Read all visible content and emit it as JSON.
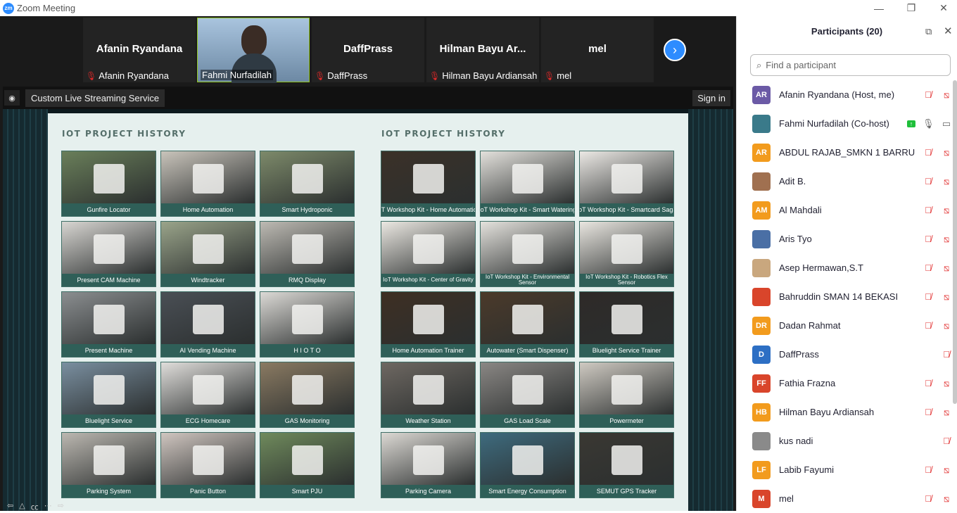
{
  "window": {
    "title": "Zoom Meeting",
    "logo": "zm"
  },
  "gallery": {
    "tiles": [
      {
        "name": "Afanin Ryandana",
        "label": "Afanin Ryandana",
        "muted": true
      },
      {
        "name": "",
        "label": "Fahmi Nurfadilah",
        "muted": false,
        "video": true
      },
      {
        "name": "DaffPrass",
        "label": "DaffPrass",
        "muted": true
      },
      {
        "name": "Hilman Bayu Ar...",
        "label": "Hilman Bayu Ardiansah",
        "muted": true
      },
      {
        "name": "mel",
        "label": "mel",
        "muted": true
      }
    ],
    "next_icon": "›"
  },
  "share": {
    "title": "Custom Live Streaming Service",
    "signin": "Sign in"
  },
  "slide": {
    "left": {
      "heading": "IOT PROJECT HISTORY",
      "cards": [
        "Gunfire Locator",
        "Home Automation",
        "Smart Hydroponic",
        "Present CAM Machine",
        "Windtracker",
        "RMQ Display",
        "Present Machine",
        "AI Vending Machine",
        "H I O T O",
        "Bluelight Service",
        "ECG Homecare",
        "GAS Monitoring",
        "Parking System",
        "Panic Button",
        "Smart PJU"
      ]
    },
    "right": {
      "heading": "IOT PROJECT HISTORY",
      "cards": [
        "IoT Workshop Kit - Home Automation",
        "IoT Workshop Kit - Smart Watering",
        "IoT Workshop Kit - Smartcard Saga",
        "IoT Workshop Kit - Center of Gravity",
        "IoT Workshop Kit - Environmental Sensor",
        "IoT Workshop Kit - Robotics Flex Sensor",
        "Home Automation Trainer",
        "Autowater (Smart Dispenser)",
        "Bluelight Service Trainer",
        "Weather Station",
        "GAS Load Scale",
        "Powermeter",
        "Parking Camera",
        "Smart Energy Consumption",
        "SEMUT GPS Tracker"
      ]
    }
  },
  "participants": {
    "title": "Participants (20)",
    "search_placeholder": "Find a participant",
    "list": [
      {
        "initials": "AR",
        "color": "#6b5aa6",
        "name": "Afanin Ryandana (Host, me)",
        "mic": "muted",
        "video": "off"
      },
      {
        "initials": "",
        "color": "#3a7a8a",
        "name": "Fahmi Nurfadilah (Co-host)",
        "mic": "on",
        "video": "on",
        "sharing": true
      },
      {
        "initials": "AR",
        "color": "#f29b1d",
        "name": "ABDUL RAJAB_SMKN 1 BARRU",
        "mic": "muted",
        "video": "off"
      },
      {
        "initials": "",
        "color": "#a07050",
        "name": "Adit B.",
        "mic": "muted",
        "video": "off"
      },
      {
        "initials": "AM",
        "color": "#f29b1d",
        "name": "Al Mahdali",
        "mic": "muted",
        "video": "off"
      },
      {
        "initials": "",
        "color": "#4a6fa5",
        "name": "Aris Tyo",
        "mic": "muted",
        "video": "off"
      },
      {
        "initials": "",
        "color": "#c9a77e",
        "name": "Asep Hermawan,S.T",
        "mic": "muted",
        "video": "off"
      },
      {
        "initials": "",
        "color": "#d9452b",
        "name": "Bahruddin SMAN 14 BEKASI",
        "mic": "muted",
        "video": "off"
      },
      {
        "initials": "DR",
        "color": "#f29b1d",
        "name": "Dadan Rahmat",
        "mic": "muted",
        "video": "off"
      },
      {
        "initials": "D",
        "color": "#2d6fc4",
        "name": "DaffPrass",
        "mic": "muted",
        "video": "none"
      },
      {
        "initials": "FF",
        "color": "#d9452b",
        "name": "Fathia Frazna",
        "mic": "muted",
        "video": "off"
      },
      {
        "initials": "HB",
        "color": "#f29b1d",
        "name": "Hilman Bayu Ardiansah",
        "mic": "muted",
        "video": "off"
      },
      {
        "initials": "",
        "color": "#8a8a8a",
        "name": "kus nadi",
        "mic": "muted",
        "video": "none"
      },
      {
        "initials": "LF",
        "color": "#f29b1d",
        "name": "Labib Fayumi",
        "mic": "muted",
        "video": "off"
      },
      {
        "initials": "M",
        "color": "#d9452b",
        "name": "mel",
        "mic": "muted",
        "video": "off"
      }
    ]
  }
}
